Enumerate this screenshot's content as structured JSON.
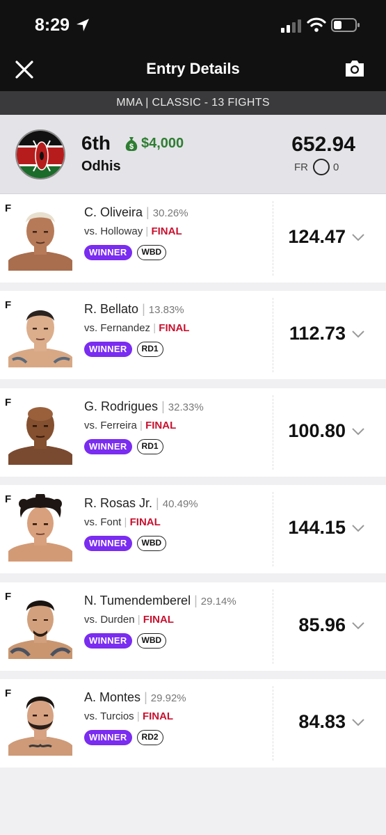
{
  "status": {
    "time": "8:29"
  },
  "nav": {
    "title": "Entry Details"
  },
  "contest": {
    "label": "MMA | CLASSIC - 13 FIGHTS"
  },
  "summary": {
    "rank": "6th",
    "prize": "$4,000",
    "username": "Odhis",
    "total": "652.94",
    "fr_label": "FR",
    "fr_value": "0"
  },
  "colors": {
    "winner_badge": "#7a2cf0",
    "final": "#c8102e",
    "prize": "#2e7d32"
  },
  "fighters": [
    {
      "pos": "F",
      "name": "C. Oliveira",
      "sep": "|",
      "ownership": "30.26%",
      "opponent": "vs. Holloway",
      "status": "FINAL",
      "result": "WINNER",
      "method": "WBD",
      "points": "124.47"
    },
    {
      "pos": "F",
      "name": "R. Bellato",
      "sep": "|",
      "ownership": "13.83%",
      "opponent": "vs. Fernandez",
      "status": "FINAL",
      "result": "WINNER",
      "method": "RD1",
      "points": "112.73"
    },
    {
      "pos": "F",
      "name": "G. Rodrigues",
      "sep": "|",
      "ownership": "32.33%",
      "opponent": "vs. Ferreira",
      "status": "FINAL",
      "result": "WINNER",
      "method": "RD1",
      "points": "100.80"
    },
    {
      "pos": "F",
      "name": "R. Rosas Jr.",
      "sep": "|",
      "ownership": "40.49%",
      "opponent": "vs. Font",
      "status": "FINAL",
      "result": "WINNER",
      "method": "WBD",
      "points": "144.15"
    },
    {
      "pos": "F",
      "name": "N. Tumendemberel",
      "sep": "|",
      "ownership": "29.14%",
      "opponent": "vs. Durden",
      "status": "FINAL",
      "result": "WINNER",
      "method": "WBD",
      "points": "85.96"
    },
    {
      "pos": "F",
      "name": "A. Montes",
      "sep": "|",
      "ownership": "29.92%",
      "opponent": "vs. Turcios",
      "status": "FINAL",
      "result": "WINNER",
      "method": "RD2",
      "points": "84.83"
    }
  ]
}
